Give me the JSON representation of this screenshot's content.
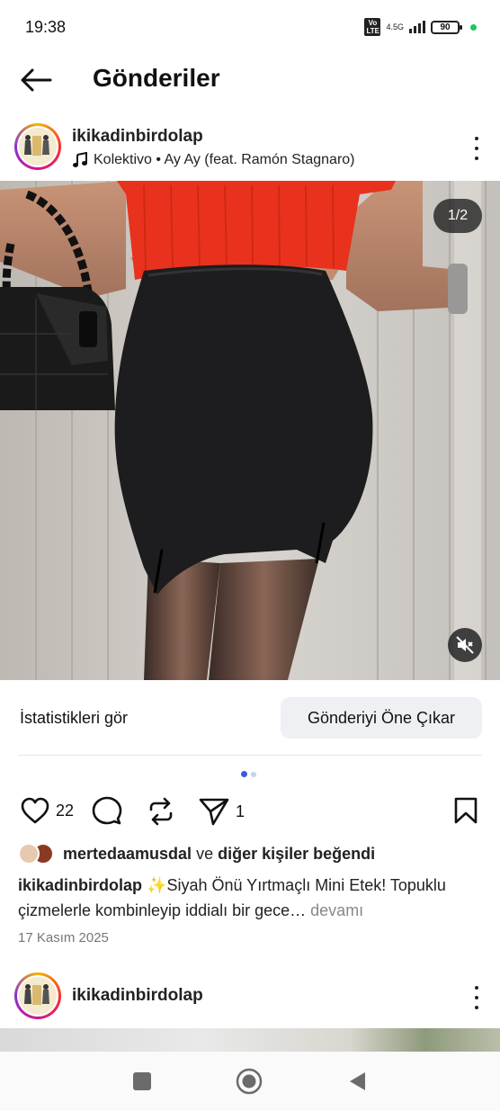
{
  "status_bar": {
    "time": "19:38",
    "volte": "Vo LTE",
    "network": "4.5G",
    "battery": "90"
  },
  "header": {
    "title": "Gönderiler"
  },
  "post": {
    "username": "ikikadinbirdolap",
    "music": "Kolektivo • Ay Ay (feat. Ramón Stagnaro)",
    "image_counter": "1/2",
    "stats_link": "İstatistikleri gör",
    "boost_button": "Gönderiyi Öne Çıkar",
    "likes_count": "22",
    "shares_count": "1",
    "liked_by_user": "mertedaamusdal",
    "liked_by_and": "ve",
    "liked_by_others": "diğer kişiler",
    "liked_by_suffix": "beğendi",
    "caption_user": "ikikadinbirdolap",
    "caption_text": "✨Siyah Önü Yırtmaçlı Mini Etek! Topuklu çizmelerle kombinleyip iddialı bir gece…",
    "caption_more": "devamı",
    "date": "17 Kasım 2025"
  },
  "next_post": {
    "username": "ikikadinbirdolap"
  },
  "colors": {
    "accent_blue": "#3b5bdb",
    "dot_inactive": "#c9d1e8",
    "battery_dot": "#22c55e"
  }
}
